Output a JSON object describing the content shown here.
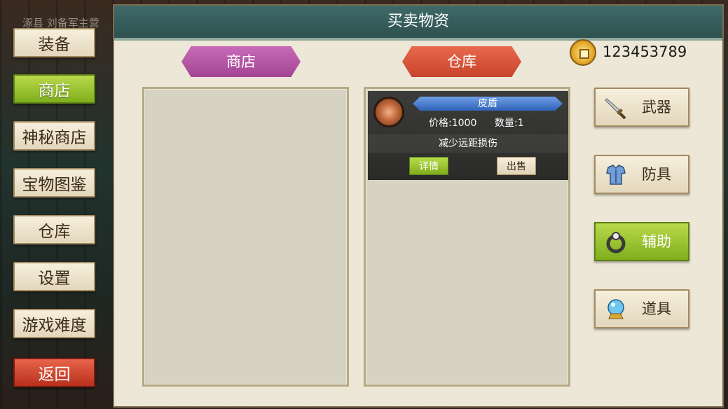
{
  "location": "涿县 刘备军主营",
  "menu": [
    {
      "label": "装备",
      "active": false
    },
    {
      "label": "商店",
      "active": true
    },
    {
      "label": "神秘商店",
      "active": false
    },
    {
      "label": "宝物图鉴",
      "active": false
    },
    {
      "label": "仓库",
      "active": false
    },
    {
      "label": "设置",
      "active": false
    },
    {
      "label": "游戏难度",
      "active": false
    }
  ],
  "back_label": "返回",
  "panel": {
    "title": "买卖物资",
    "shop_tab": "商店",
    "warehouse_tab": "仓库",
    "gold": "123453789"
  },
  "warehouse_items": [
    {
      "name": "皮盾",
      "price": "价格:1000",
      "quantity": "数量:1",
      "description": "减少远距损伤",
      "detail_label": "详情",
      "sell_label": "出售",
      "icon": "leather-shield-icon"
    }
  ],
  "categories": [
    {
      "label": "武器",
      "icon": "sword-icon",
      "active": false
    },
    {
      "label": "防具",
      "icon": "armor-icon",
      "active": false
    },
    {
      "label": "辅助",
      "icon": "ring-icon",
      "active": true
    },
    {
      "label": "道具",
      "icon": "crystal-ball-icon",
      "active": false
    }
  ],
  "colors": {
    "accent_green": "#7fae1c",
    "shop_purple": "#a34594",
    "warehouse_red": "#c8432b",
    "header_teal": "#2e5150"
  }
}
